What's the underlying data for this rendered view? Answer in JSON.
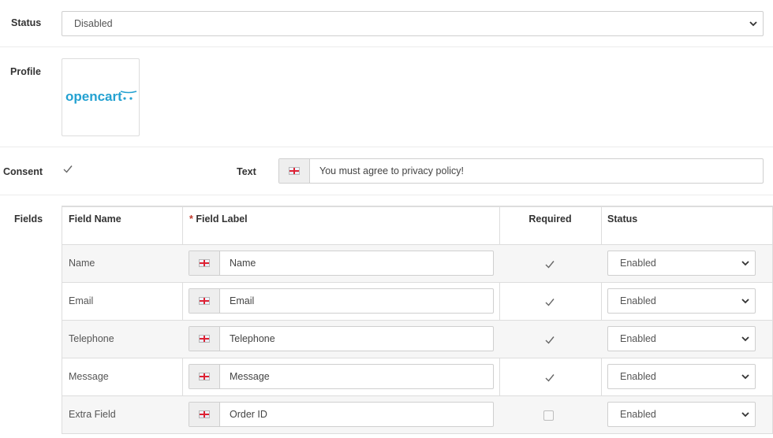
{
  "status": {
    "label": "Status",
    "value": "Disabled"
  },
  "profile": {
    "label": "Profile",
    "logo_text": "opencart"
  },
  "consent": {
    "label": "Consent",
    "checked": true,
    "text_label": "Text",
    "text_value": "You must agree to privacy policy!"
  },
  "fields": {
    "label": "Fields",
    "headers": {
      "name": "Field Name",
      "required_mark": "*",
      "label": "Field Label",
      "required": "Required",
      "status": "Status"
    },
    "rows": [
      {
        "name": "Name",
        "label_value": "Name",
        "required": true,
        "status": "Enabled"
      },
      {
        "name": "Email",
        "label_value": "Email",
        "required": true,
        "status": "Enabled"
      },
      {
        "name": "Telephone",
        "label_value": "Telephone",
        "required": true,
        "status": "Enabled"
      },
      {
        "name": "Message",
        "label_value": "Message",
        "required": true,
        "status": "Enabled"
      },
      {
        "name": "Extra Field",
        "label_value": "Order ID",
        "required": false,
        "status": "Enabled"
      }
    ]
  },
  "colors": {
    "logo": "#23a1d1",
    "accent_required": "#c0392b"
  }
}
